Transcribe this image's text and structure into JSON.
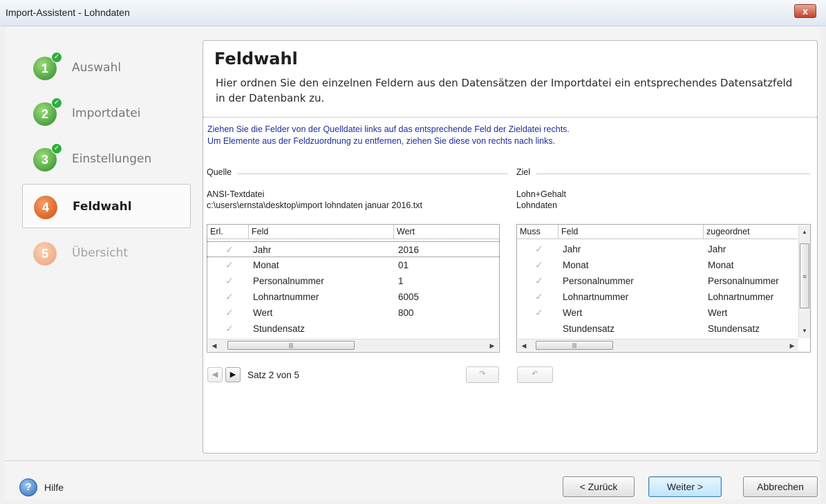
{
  "window": {
    "title": "Import-Assistent - Lohndaten",
    "close_symbol": "x"
  },
  "steps": [
    {
      "number": "1",
      "label": "Auswahl",
      "state": "done"
    },
    {
      "number": "2",
      "label": "Importdatei",
      "state": "done"
    },
    {
      "number": "3",
      "label": "Einstellungen",
      "state": "done"
    },
    {
      "number": "4",
      "label": "Feldwahl",
      "state": "active"
    },
    {
      "number": "5",
      "label": "Übersicht",
      "state": "pending"
    }
  ],
  "panel": {
    "heading": "Feldwahl",
    "description": "Hier ordnen Sie den einzelnen Feldern aus den Datensätzen der Importdatei ein entsprechendes Datensatzfeld in der Datenbank zu.",
    "instruction_line1": "Ziehen Sie die Felder von der Quelldatei links auf das entsprechende Feld der Zieldatei rechts.",
    "instruction_line2": "Um Elemente aus der Feldzuordnung zu entfernen, ziehen Sie diese von rechts nach links."
  },
  "source": {
    "group_label": "Quelle",
    "file_type": "ANSI-Textdatei",
    "file_path": "c:\\users\\ernsta\\desktop\\import lohndaten januar 2016.txt",
    "columns": [
      "Erl.",
      "Feld",
      "Wert"
    ],
    "rows": [
      {
        "check": "✓",
        "field": "Jahr",
        "value": "2016"
      },
      {
        "check": "✓",
        "field": "Monat",
        "value": "01"
      },
      {
        "check": "✓",
        "field": "Personalnummer",
        "value": "1"
      },
      {
        "check": "✓",
        "field": "Lohnartnummer",
        "value": "6005"
      },
      {
        "check": "✓",
        "field": "Wert",
        "value": "800"
      },
      {
        "check": "✓",
        "field": "Stundensatz",
        "value": ""
      }
    ],
    "record_text": "Satz 2 von 5"
  },
  "target": {
    "group_label": "Ziel",
    "line1": "Lohn+Gehalt",
    "line2": "Lohndaten",
    "columns": [
      "Muss",
      "Feld",
      "zugeordnet"
    ],
    "rows": [
      {
        "check": "✓",
        "field": "Jahr",
        "assigned": "Jahr"
      },
      {
        "check": "✓",
        "field": "Monat",
        "assigned": "Monat"
      },
      {
        "check": "✓",
        "field": "Personalnummer",
        "assigned": "Personalnummer"
      },
      {
        "check": "✓",
        "field": "Lohnartnummer",
        "assigned": "Lohnartnummer"
      },
      {
        "check": "✓",
        "field": "Wert",
        "assigned": "Wert"
      },
      {
        "check": "",
        "field": "Stundensatz",
        "assigned": "Stundensatz"
      }
    ]
  },
  "icons": {
    "help": "help-icon",
    "prev_record": "triangle-left-icon",
    "next_record": "triangle-right-icon",
    "redo": "redo-icon",
    "undo": "undo-icon",
    "check": "checkmark-icon"
  },
  "footer": {
    "help_label": "Hilfe",
    "back_label": "< Zurück",
    "next_label": "Weiter >",
    "cancel_label": "Abbrechen"
  },
  "colors": {
    "step_done": "#2c8a28",
    "step_active": "#d04b0c",
    "step_pending": "#eba27a",
    "instruction_text": "#1c2f9c",
    "close_button": "#c4432c"
  }
}
